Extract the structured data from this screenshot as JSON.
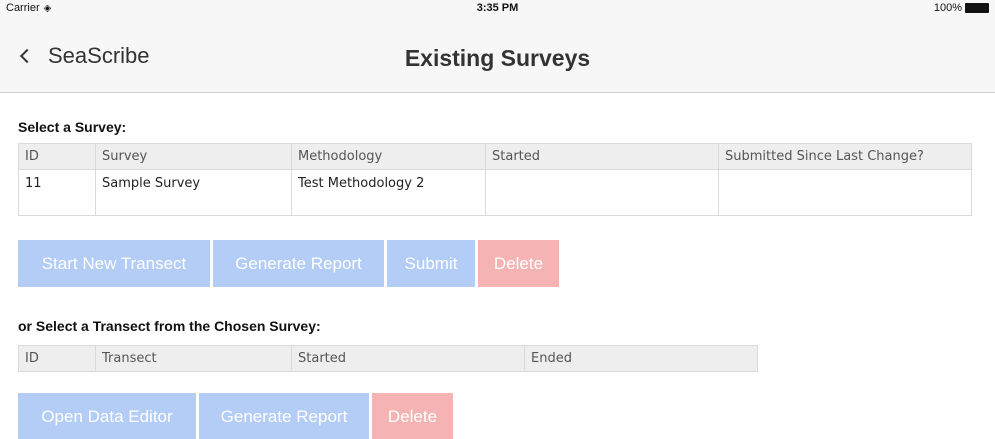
{
  "status_bar": {
    "carrier": "Carrier",
    "time": "3:35 PM",
    "battery": "100%"
  },
  "nav": {
    "back_label": "SeaScribe",
    "title": "Existing Surveys"
  },
  "survey_section": {
    "label": "Select a Survey:",
    "columns": [
      "ID",
      "Survey",
      "Methodology",
      "Started",
      "Submitted Since Last Change?"
    ],
    "rows": [
      [
        "11",
        "Sample Survey",
        "Test Methodology 2",
        "",
        ""
      ]
    ],
    "buttons": {
      "start_new_transect": "Start New Transect",
      "generate_report": "Generate Report",
      "submit": "Submit",
      "delete": "Delete"
    }
  },
  "transect_section": {
    "label": "or Select a Transect from the Chosen Survey:",
    "columns": [
      "ID",
      "Transect",
      "Started",
      "Ended"
    ],
    "buttons": {
      "open_data_editor": "Open Data Editor",
      "generate_report": "Generate Report",
      "delete": "Delete"
    }
  },
  "colors": {
    "primary_button": "#b3cdf6",
    "danger_button": "#f6b3b3",
    "header_bg": "#f7f7f7"
  }
}
